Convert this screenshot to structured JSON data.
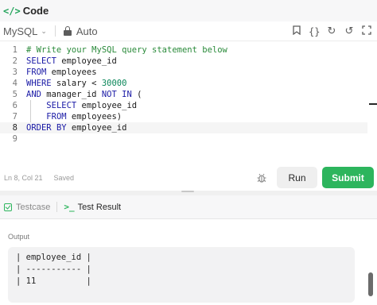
{
  "header": {
    "icon": "code-icon",
    "title": "Code"
  },
  "toolbar": {
    "language": "MySQL",
    "mode": "Auto",
    "icons": [
      "bookmark-icon",
      "braces-icon",
      "reset-icon",
      "undo-icon",
      "fullscreen-icon"
    ]
  },
  "editor": {
    "lines": [
      {
        "n": "1",
        "text": "# Write your MySQL query statement below"
      },
      {
        "n": "2",
        "text": "SELECT employee_id"
      },
      {
        "n": "3",
        "text": "FROM employees"
      },
      {
        "n": "4",
        "text": "WHERE salary < 30000"
      },
      {
        "n": "5",
        "text": "AND manager_id NOT IN ("
      },
      {
        "n": "6",
        "text": "    SELECT employee_id"
      },
      {
        "n": "7",
        "text": "    FROM employees)"
      },
      {
        "n": "8",
        "text": "ORDER BY employee_id"
      },
      {
        "n": "9",
        "text": ""
      }
    ],
    "active_line": 8
  },
  "status": {
    "position": "Ln 8, Col 21",
    "saved": "Saved"
  },
  "actions": {
    "run": "Run",
    "submit": "Submit"
  },
  "panel": {
    "tab_testcase": "Testcase",
    "tab_result": "Test Result",
    "output_label": "Output",
    "output_lines": [
      "| employee_id |",
      "| ----------- |",
      "| 11          |"
    ]
  },
  "colors": {
    "accent_green": "#2db55d",
    "keyword": "#1a1aa6",
    "comment": "#2a8a3a"
  }
}
